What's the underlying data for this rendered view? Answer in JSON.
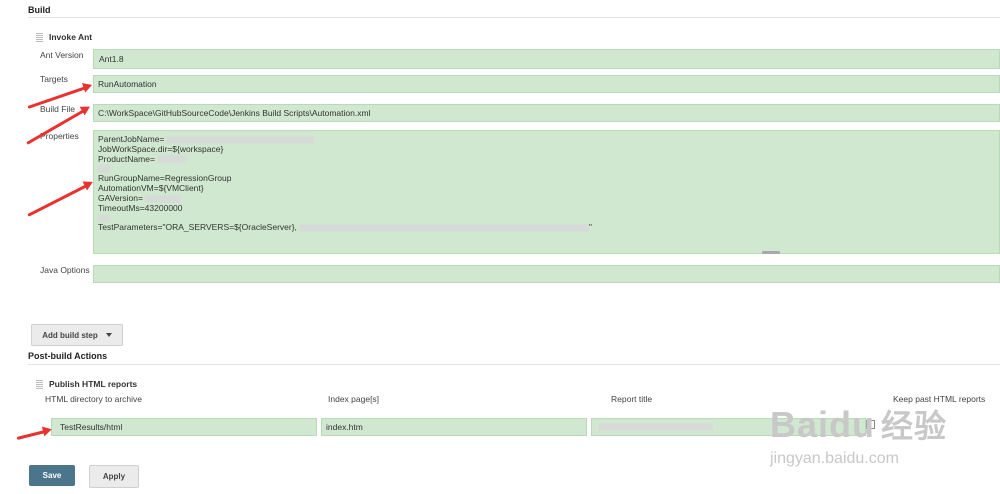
{
  "build": {
    "title": "Build",
    "invoke_ant": {
      "title": "Invoke Ant",
      "ant_version_label": "Ant Version",
      "ant_version_value": "Ant1.8",
      "targets_label": "Targets",
      "targets_value": "RunAutomation",
      "build_file_label": "Build File",
      "build_file_value": "C:\\WorkSpace\\GitHubSourceCode\\Jenkins Build Scripts\\Automation.xml",
      "properties_label": "Properties",
      "properties_lines": [
        "ParentJobName=",
        "JobWorkSpace.dir=${workspace}",
        "ProductName=",
        "",
        "RunGroupName=RegressionGroup",
        "AutomationVM=${VMClient}",
        "GAVersion=",
        "TimeoutMs=43200000",
        "",
        "TestParameters=\"ORA_SERVERS=${OracleServer},",
        "\""
      ],
      "java_options_label": "Java Options",
      "java_options_value": ""
    },
    "add_build_step_label": "Add build step"
  },
  "post_build": {
    "title": "Post-build Actions",
    "publish_html": {
      "title": "Publish HTML reports",
      "col_dir_label": "HTML directory to archive",
      "col_index_label": "Index page[s]",
      "col_report_title_label": "Report title",
      "col_keep_past_label": "Keep past HTML reports",
      "dir_value": "TestResults/html",
      "index_value": "index.htm",
      "report_title_value": ""
    }
  },
  "actions": {
    "save_label": "Save",
    "apply_label": "Apply"
  },
  "watermark": {
    "logo_text": "Baidu",
    "logo_cn": "经验",
    "url": "jingyan.baidu.com"
  },
  "colors": {
    "field_bg": "#cfe8cf",
    "primary_button": "#4b758b",
    "arrow": "#e8322f"
  }
}
